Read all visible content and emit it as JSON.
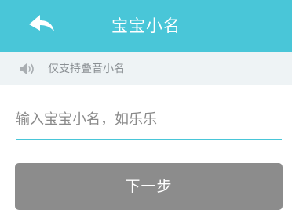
{
  "header": {
    "title": "宝宝小名",
    "back_icon": "back-arrow-icon",
    "background_color": "#49c6d8"
  },
  "notice": {
    "icon": "speaker-icon",
    "text": "仅支持叠音小名"
  },
  "name_input": {
    "placeholder": "输入宝宝小名，如乐乐",
    "value": "",
    "underline_color": "#49c6d8"
  },
  "next_button": {
    "label": "下一步",
    "background_color": "#8c8c8c",
    "state": "disabled"
  }
}
